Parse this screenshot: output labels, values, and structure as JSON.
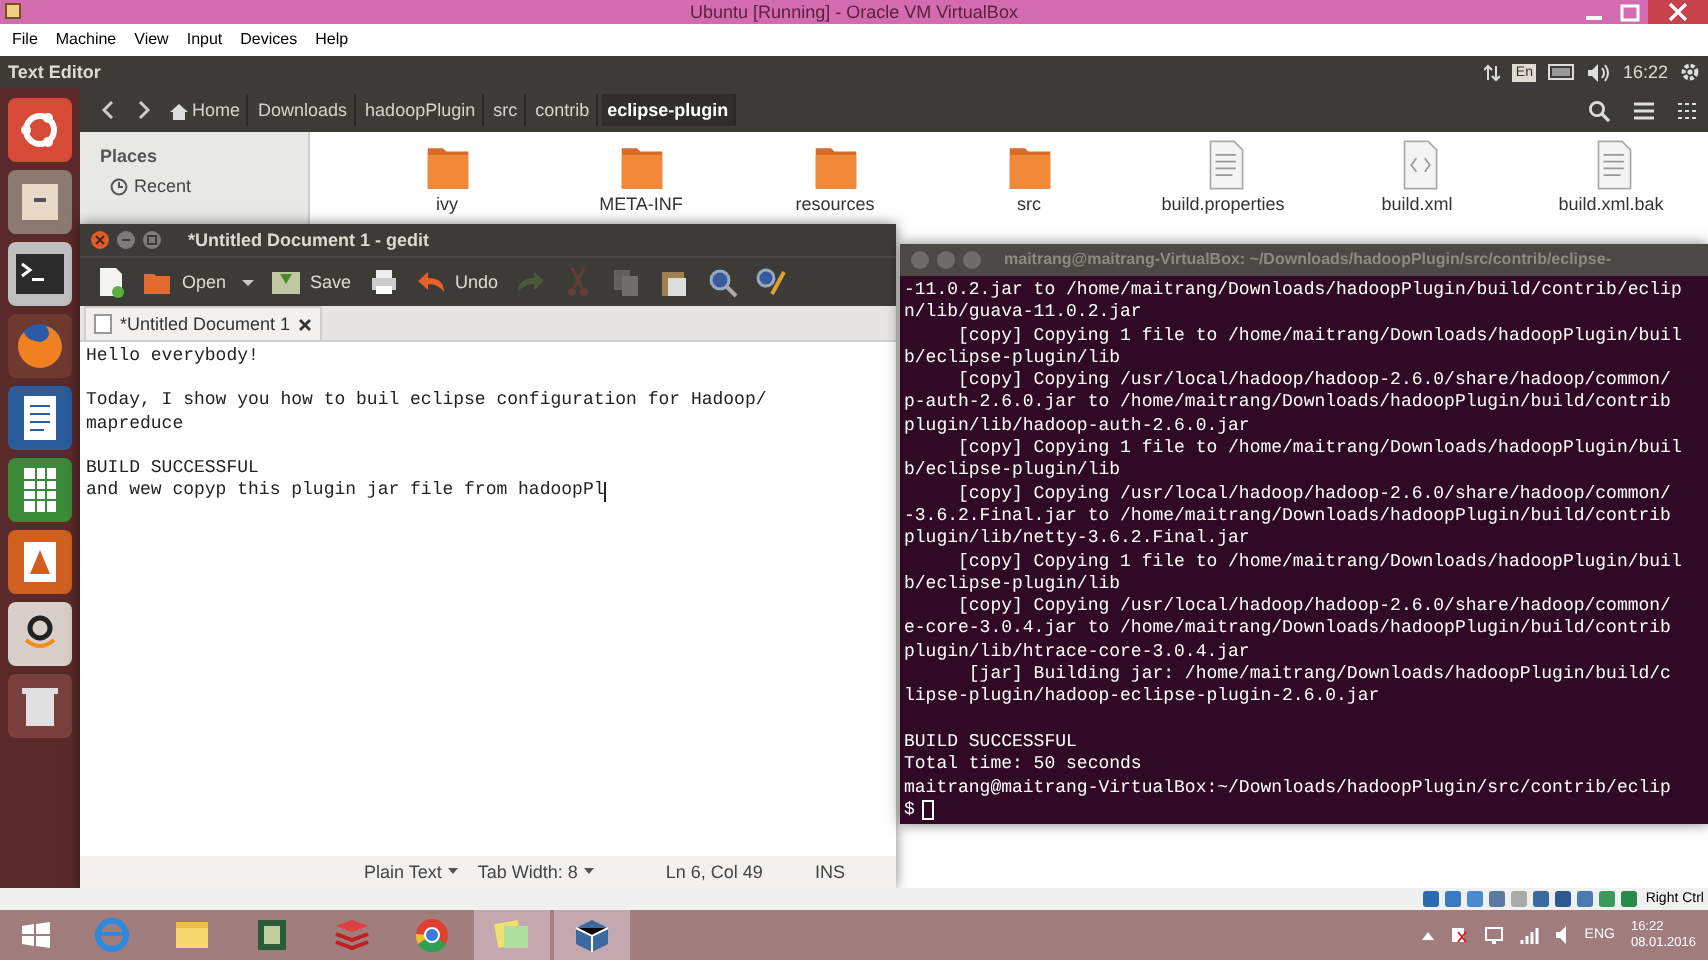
{
  "host_window": {
    "title": "Ubuntu [Running] - Oracle VM VirtualBox",
    "menu": [
      "File",
      "Machine",
      "View",
      "Input",
      "Devices",
      "Help"
    ]
  },
  "top_panel": {
    "app_name": "Text Editor",
    "keyboard": "En",
    "time": "16:22"
  },
  "file_manager": {
    "breadcrumbs": [
      {
        "label": "Home",
        "selected": false
      },
      {
        "label": "Downloads",
        "selected": false
      },
      {
        "label": "hadoopPlugin",
        "selected": false
      },
      {
        "label": "src",
        "selected": false
      },
      {
        "label": "contrib",
        "selected": false
      },
      {
        "label": "eclipse-plugin",
        "selected": true
      }
    ],
    "places_heading": "Places",
    "places": [
      "Recent"
    ],
    "files": [
      {
        "name": "ivy",
        "kind": "folder"
      },
      {
        "name": "META-INF",
        "kind": "folder"
      },
      {
        "name": "resources",
        "kind": "folder"
      },
      {
        "name": "src",
        "kind": "folder"
      },
      {
        "name": "build.properties",
        "kind": "text"
      },
      {
        "name": "build.xml",
        "kind": "xml"
      },
      {
        "name": "build.xml.bak",
        "kind": "text"
      }
    ]
  },
  "editor": {
    "title": "*Untitled Document 1 - gedit",
    "toolbar": [
      {
        "kind": "new",
        "disabled": false
      },
      {
        "kind": "open",
        "label": "Open",
        "disabled": false
      },
      {
        "kind": "dropdown",
        "disabled": false
      },
      {
        "kind": "save",
        "label": "Save",
        "disabled": false
      },
      {
        "kind": "print",
        "disabled": false
      },
      {
        "kind": "undo",
        "label": "Undo",
        "disabled": false
      },
      {
        "kind": "redo",
        "disabled": true
      },
      {
        "kind": "cut",
        "disabled": true
      },
      {
        "kind": "copy",
        "disabled": true
      },
      {
        "kind": "paste",
        "disabled": false
      },
      {
        "kind": "search",
        "disabled": false
      },
      {
        "kind": "replace",
        "disabled": false
      }
    ],
    "tab": {
      "label": "*Untitled Document 1"
    },
    "blocks": [
      [
        "Hello everybody!"
      ],
      [
        "Today, I show you how to buil eclipse configuration for Hadoop/",
        "mapreduce"
      ],
      [
        "BUILD SUCCESSFUL",
        "and wew copyp this plugin jar file from hadoopPl"
      ]
    ],
    "status": {
      "language": "Plain Text",
      "tab_width": "Tab Width: 8",
      "position": "Ln 6, Col 49",
      "mode": "INS"
    }
  },
  "terminal": {
    "title": "maitrang@maitrang-VirtualBox: ~/Downloads/hadoopPlugin/src/contrib/eclipse-",
    "blocks": [
      [
        "-11.0.2.jar to /home/maitrang/Downloads/hadoopPlugin/build/contrib/eclip",
        "n/lib/guava-11.0.2.jar",
        "     [copy] Copying 1 file to /home/maitrang/Downloads/hadoopPlugin/buil",
        "b/eclipse-plugin/lib",
        "     [copy] Copying /usr/local/hadoop/hadoop-2.6.0/share/hadoop/common/",
        "p-auth-2.6.0.jar to /home/maitrang/Downloads/hadoopPlugin/build/contrib",
        "plugin/lib/hadoop-auth-2.6.0.jar",
        "     [copy] Copying 1 file to /home/maitrang/Downloads/hadoopPlugin/buil",
        "b/eclipse-plugin/lib",
        "     [copy] Copying /usr/local/hadoop/hadoop-2.6.0/share/hadoop/common/",
        "-3.6.2.Final.jar to /home/maitrang/Downloads/hadoopPlugin/build/contrib",
        "plugin/lib/netty-3.6.2.Final.jar",
        "     [copy] Copying 1 file to /home/maitrang/Downloads/hadoopPlugin/buil",
        "b/eclipse-plugin/lib",
        "     [copy] Copying /usr/local/hadoop/hadoop-2.6.0/share/hadoop/common/",
        "e-core-3.0.4.jar to /home/maitrang/Downloads/hadoopPlugin/build/contrib",
        "plugin/lib/htrace-core-3.0.4.jar",
        "      [jar] Building jar: /home/maitrang/Downloads/hadoopPlugin/build/c",
        "lipse-plugin/hadoop-eclipse-plugin-2.6.0.jar"
      ],
      [
        "BUILD SUCCESSFUL",
        "Total time: 50 seconds",
        "maitrang@maitrang-VirtualBox:~/Downloads/hadoopPlugin/src/contrib/eclip"
      ]
    ],
    "prompt": "$"
  },
  "vbox_status": {
    "host_key": "Right Ctrl"
  },
  "taskbar": {
    "language": "ENG",
    "time": "16:22",
    "date": "08.01.2016"
  }
}
